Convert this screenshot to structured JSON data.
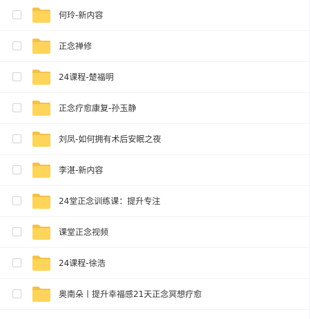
{
  "folder_color": "#ffd45a",
  "folder_tab_color": "#f4c14a",
  "files": [
    {
      "name": "何玲-新内容",
      "icon": "folder-icon",
      "checked": false
    },
    {
      "name": "正念禅修",
      "icon": "folder-icon",
      "checked": false
    },
    {
      "name": "24课程-楚福明",
      "icon": "folder-icon",
      "checked": false
    },
    {
      "name": "正念疗愈康复-孙玉静",
      "icon": "folder-icon",
      "checked": false
    },
    {
      "name": "刘凤-如何拥有术后安眠之夜",
      "icon": "folder-icon",
      "checked": false
    },
    {
      "name": "李湛-新内容",
      "icon": "folder-icon",
      "checked": false
    },
    {
      "name": "24堂正念训练课：提升专注",
      "icon": "folder-icon",
      "checked": false
    },
    {
      "name": "课堂正念视频",
      "icon": "folder-icon",
      "checked": false
    },
    {
      "name": "24课程-徐浩",
      "icon": "folder-icon",
      "checked": false
    },
    {
      "name": "奥南朵丨提升幸福感21天正念冥想疗愈",
      "icon": "folder-icon",
      "checked": false
    }
  ]
}
